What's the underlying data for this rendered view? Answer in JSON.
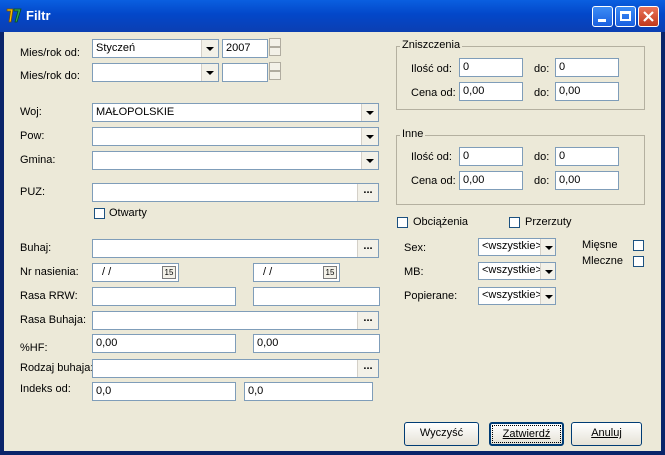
{
  "window": {
    "title": "Filtr"
  },
  "left": {
    "mies_od_label": "Mies/rok od:",
    "mies_od_month": "Styczeń",
    "mies_od_year": "2007",
    "mies_do_label": "Mies/rok do:",
    "mies_do_month": "",
    "mies_do_year": "",
    "woj_label": "Woj:",
    "woj_value": "MAŁOPOLSKIE",
    "pow_label": "Pow:",
    "pow_value": "",
    "gmina_label": "Gmina:",
    "gmina_value": "",
    "puz_label": "PUZ:",
    "puz_value": "",
    "otwarty_label": "Otwarty",
    "buhaj_label": "Buhaj:",
    "buhaj_value": "",
    "nr_nasienia_label": "Nr nasienia:",
    "date1": "/ /",
    "date2": "/ /",
    "cal_icon_text": "15",
    "rasa_rrw_label": "Rasa RRW:",
    "rasa_rrw_1": "",
    "rasa_rrw_2": "",
    "rasa_buhaja_label": "Rasa Buhaja:",
    "rasa_buhaja_value": "",
    "hf_label": "%HF:",
    "hf_1": "0,00",
    "hf_2": "0,00",
    "rodzaj_buhaja_label": "Rodzaj buhaja:",
    "rodzaj_buhaja_value": "",
    "indeks_label": "Indeks od:",
    "indeks_1": "0,0",
    "indeks_2": "0,0",
    "dots": "..."
  },
  "zniszczenia": {
    "title": "Zniszczenia",
    "ilosc_od_label": "Ilość od:",
    "ilosc_od": "0",
    "do_label": "do:",
    "ilosc_do": "0",
    "cena_od_label": "Cena od:",
    "cena_od": "0,00",
    "cena_do": "0,00"
  },
  "inne": {
    "title": "Inne",
    "ilosc_od_label": "Ilość od:",
    "ilosc_od": "0",
    "do_label": "do:",
    "ilosc_do": "0",
    "cena_od_label": "Cena od:",
    "cena_od": "0,00",
    "cena_do": "0,00"
  },
  "right": {
    "obciazenia_label": "Obciążenia",
    "przerzuty_label": "Przerzuty",
    "sex_label": "Sex:",
    "sex_value": "<wszystkie>",
    "mb_label": "MB:",
    "mb_value": "<wszystkie>",
    "popierane_label": "Popierane:",
    "popierane_value": "<wszystkie>",
    "miesne_label": "Mięsne",
    "mleczne_label": "Mleczne"
  },
  "buttons": {
    "wyczysc": "Wyczyść",
    "zatwierdz": "Zatwierdź",
    "anuluj": "Anuluj"
  }
}
